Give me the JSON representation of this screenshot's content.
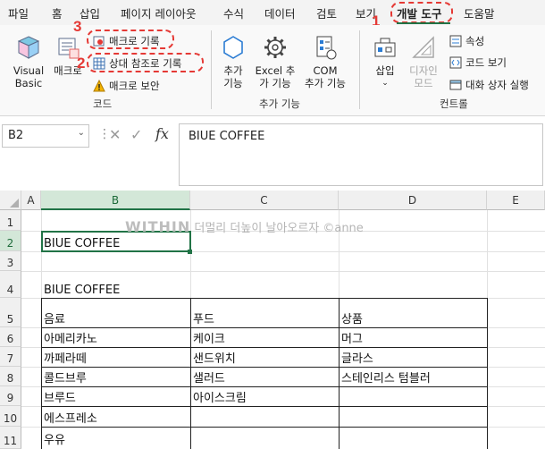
{
  "tabs": [
    "파일",
    "홈",
    "삽입",
    "페이지 레이아웃",
    "수식",
    "데이터",
    "검토",
    "보기",
    "개발 도구",
    "도움말"
  ],
  "active_tab": "개발 도구",
  "annotations": {
    "n1": "1",
    "n2": "2",
    "n3": "3"
  },
  "ribbon": {
    "code_group": "코드",
    "visual_basic": "Visual\nBasic",
    "macro": "매크로",
    "record_macro": "매크로 기록",
    "relative_ref": "상대 참조로 기록",
    "macro_security": "매크로 보안",
    "addins_group": "추가 기능",
    "addins": "추가\n기능",
    "excel_addins": "Excel 추\n가 기능",
    "com_addins": "COM\n추가 기능",
    "controls_group": "컨트롤",
    "insert": "삽입",
    "design_mode": "디자인\n모드",
    "properties": "속성",
    "view_code": "코드 보기",
    "run_dialog": "대화 상자 실행"
  },
  "formula_bar": {
    "name_box": "B2",
    "formula": "BIUE COFFEE"
  },
  "columns": [
    "A",
    "B",
    "C",
    "D",
    "E"
  ],
  "rows": [
    "1",
    "2",
    "3",
    "4",
    "5",
    "6",
    "7",
    "8",
    "9",
    "10",
    "11"
  ],
  "cells": {
    "B2": "BIUE COFFEE",
    "B4": "BIUE COFFEE",
    "B5": "음료",
    "C5": "푸드",
    "D5": "상품",
    "B6": "아메리카노",
    "C6": "케이크",
    "D6": "머그",
    "B7": "까페라떼",
    "C7": "샌드위치",
    "D7": "글라스",
    "B8": "콜드브루",
    "C8": "샐러드",
    "D8": "스테인리스 텀블러",
    "B9": "브루드",
    "C9": "아이스크림",
    "B10": "에스프레소",
    "B11": "우유"
  },
  "watermark": {
    "brand": "WITHIN",
    "text": "더멀리 더높이 날아오르자 ©anne"
  }
}
